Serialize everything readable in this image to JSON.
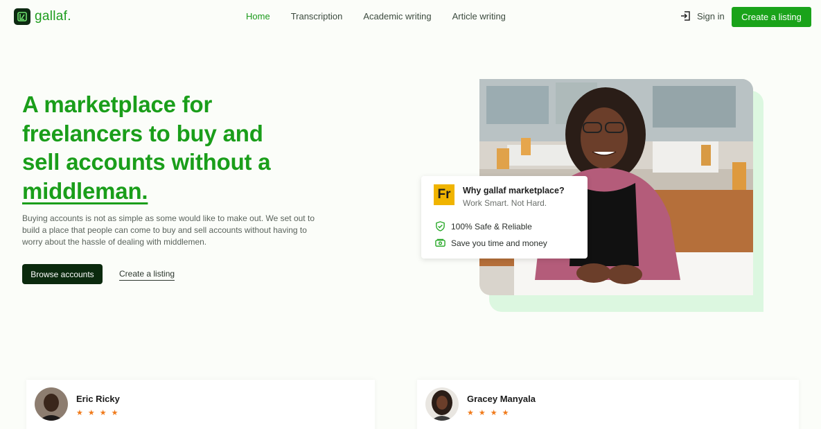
{
  "brand": {
    "name": "gallaf.",
    "primary_color": "#1aa31a",
    "dark_color": "#0b2a0e"
  },
  "nav": {
    "links": [
      "Home",
      "Transcription",
      "Academic writing",
      "Article writing"
    ],
    "active": "Home",
    "signin": "Sign in",
    "cta": "Create a listing"
  },
  "hero": {
    "title_part1": "A marketplace for freelancers to buy and sell accounts without a",
    "title_part2": "middleman.",
    "description": "Buying accounts is not as simple as some would like to make out. We set out to build a place that people can come to buy and sell accounts without having to worry about the hassle of dealing with middlemen.",
    "primary_button": "Browse accounts",
    "secondary_link": "Create a listing"
  },
  "card": {
    "logo": "Fr",
    "title": "Why gallaf marketplace?",
    "subtitle": "Work Smart. Not Hard.",
    "features": [
      {
        "icon": "shield-check-icon",
        "label": "100% Safe & Reliable"
      },
      {
        "icon": "money-icon",
        "label": "Save you time and money"
      }
    ]
  },
  "testimonials": [
    {
      "name": "Eric Ricky",
      "rating": 4,
      "stars": "★★★★"
    },
    {
      "name": "Gracey Manyala",
      "rating": 4,
      "stars": "★★★★"
    }
  ]
}
